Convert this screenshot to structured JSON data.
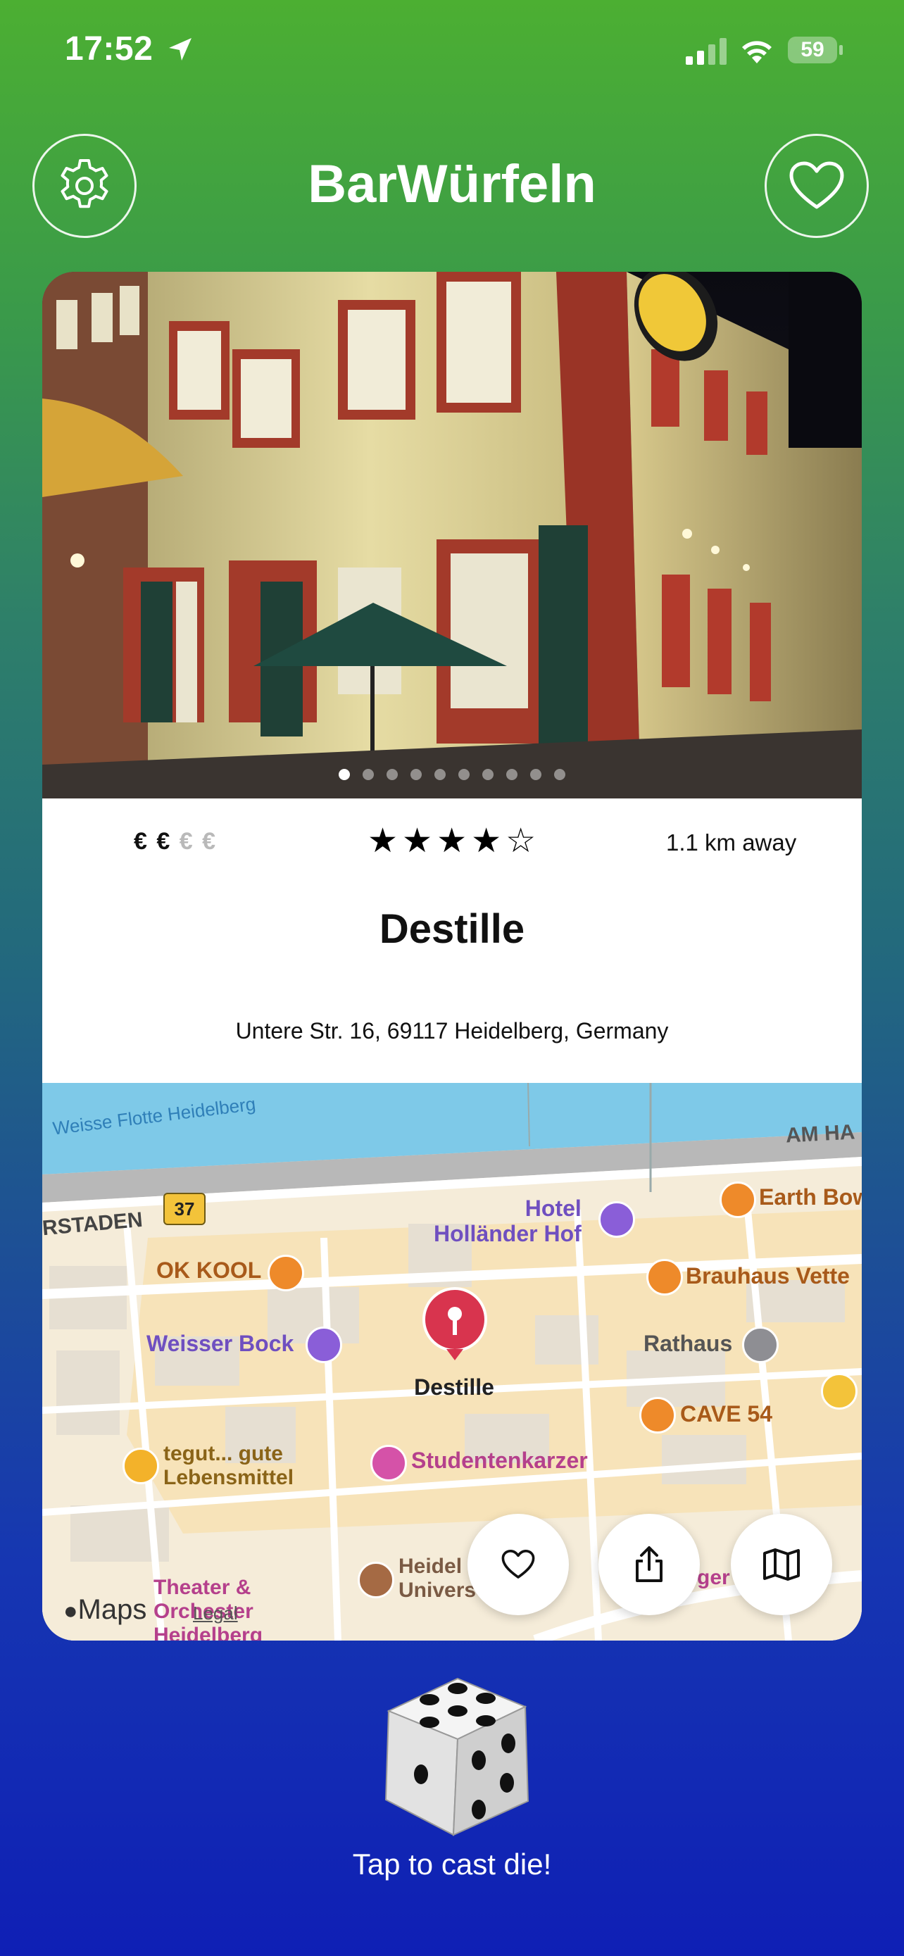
{
  "status_bar": {
    "time": "17:52",
    "battery": "59"
  },
  "header": {
    "title": "BarWürfeln"
  },
  "venue": {
    "price_level": 2,
    "price_symbol": "€",
    "price_filled": "€ €",
    "price_empty": "€ €",
    "rating": 4,
    "rating_stars": "★★★★☆",
    "distance": "1.1 km away",
    "name": "Destille",
    "address": "Untere Str. 16, 69117 Heidelberg, Germany",
    "photo_count": 10,
    "photo_active_index": 0
  },
  "map": {
    "labels": {
      "river": "Weisse Flotte Heidelberg",
      "road_am": "AM HA",
      "road_staden": "RSTADEN",
      "route": "37",
      "hotel": "Hotel\nHolländer Hof",
      "earth": "Earth Bow",
      "ok_kool": "OK KOOL",
      "brauhaus": "Brauhaus Vette",
      "weisser_bock": "Weisser Bock",
      "rathaus": "Rathaus",
      "pin": "Destille",
      "cave": "CAVE 54",
      "tegut": "tegut... gute\nLebensmittel",
      "studentenkarzer": "Studentenkarzer",
      "theater": "Theater &\nOrchester\nHeidelberg",
      "uni": "Heidel\nUnivers",
      "ger": "ger",
      "maps_brand": "Maps",
      "legal": "Legal"
    }
  },
  "footer": {
    "cast_label": "Tap to cast die!"
  },
  "colors": {
    "gradient_top": "#4caf32",
    "gradient_bottom": "#0f1fb5",
    "pin": "#d8344e"
  }
}
